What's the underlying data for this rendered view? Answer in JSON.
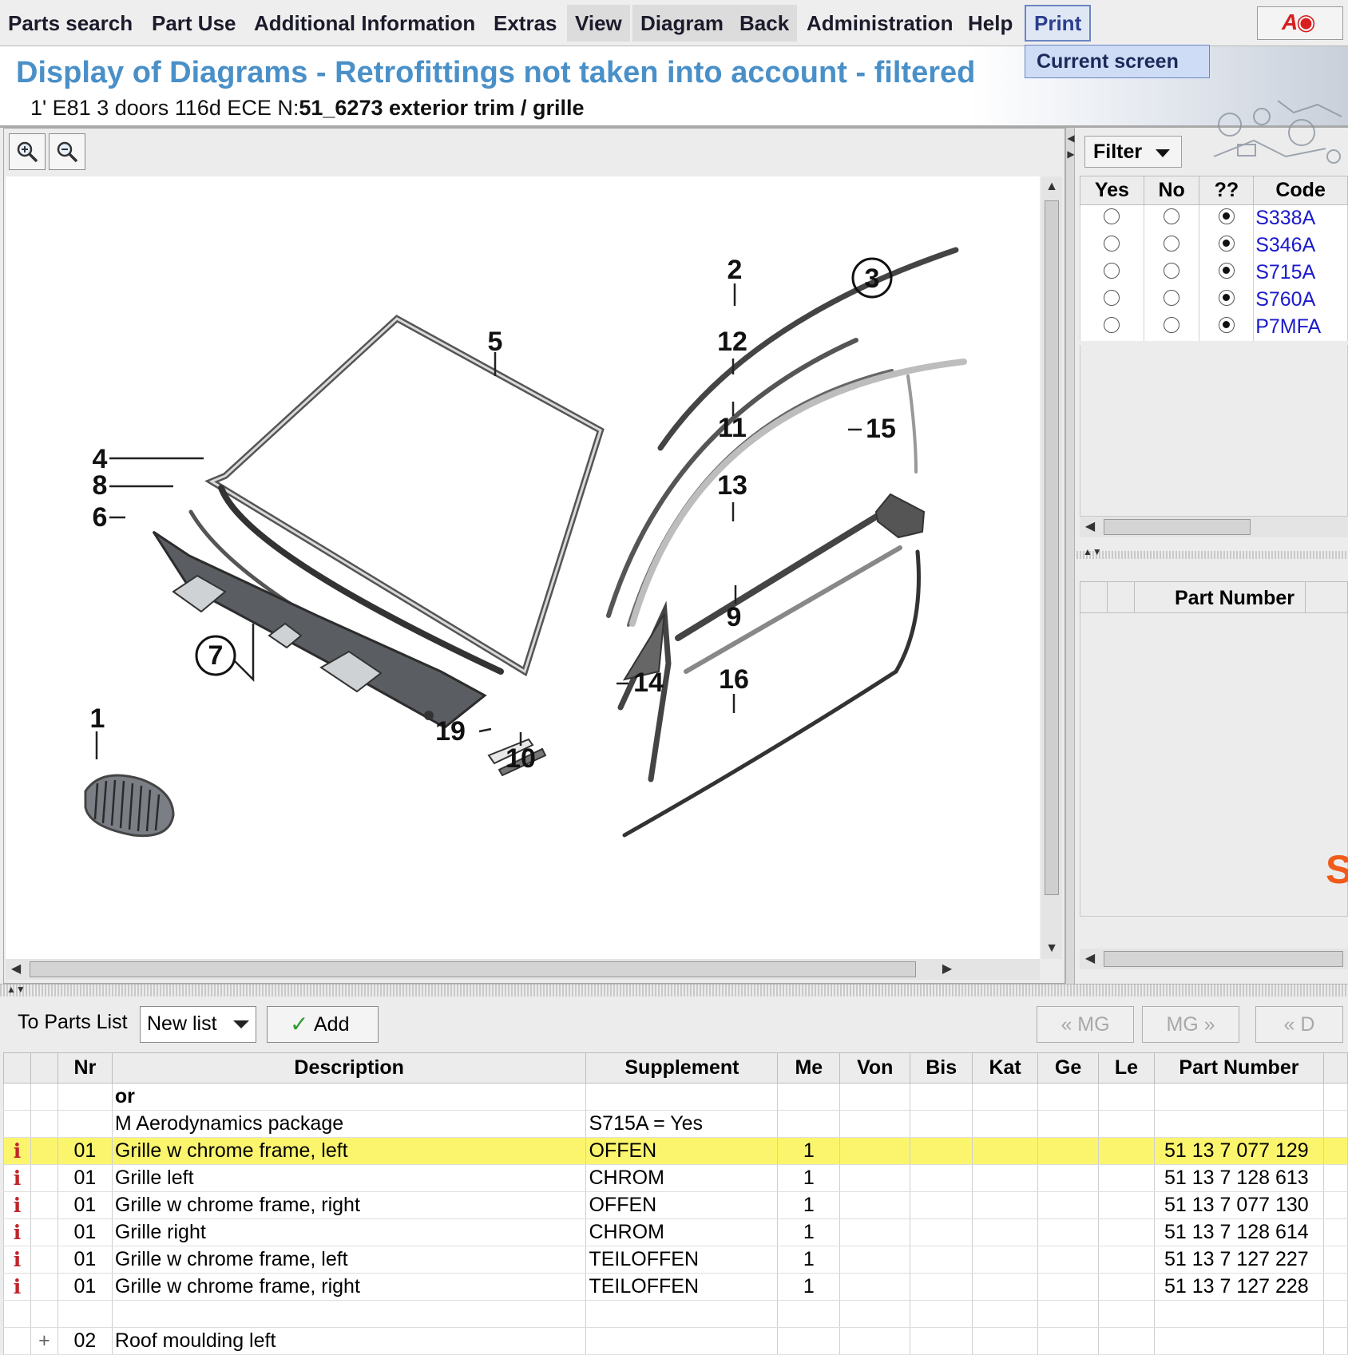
{
  "menu": [
    {
      "label": "Parts search"
    },
    {
      "label": "Part Use"
    },
    {
      "label": "Additional Information"
    },
    {
      "label": "Extras"
    },
    {
      "label": "View"
    },
    {
      "label": "Diagram"
    },
    {
      "label": "Back"
    },
    {
      "label": "Administration"
    },
    {
      "label": "Help"
    },
    {
      "label": "Print"
    }
  ],
  "print_menu": {
    "current_screen": "Current screen"
  },
  "header": {
    "title": "Display of Diagrams - Retrofittings not taken into account - filtered",
    "vehicle": "1' E81 3 doors 116d ECE  N:",
    "diagram": "51_6273 exterior trim / grille"
  },
  "diagram_labels": [
    "1",
    "2",
    "3",
    "4",
    "5",
    "6",
    "7",
    "8",
    "9",
    "10",
    "11",
    "12",
    "13",
    "14",
    "15",
    "16",
    "19"
  ],
  "filter": {
    "button_label": "Filter",
    "columns": [
      "Yes",
      "No",
      "??",
      "Code"
    ],
    "rows": [
      {
        "code": "S338A",
        "selected": "??"
      },
      {
        "code": "S346A",
        "selected": "??"
      },
      {
        "code": "S715A",
        "selected": "??"
      },
      {
        "code": "S760A",
        "selected": "??"
      },
      {
        "code": "P7MFA",
        "selected": "??"
      }
    ]
  },
  "right_parts_header": "Part Number",
  "parts_toolbar": {
    "to_parts_list": "To Parts List",
    "list_value": "New list",
    "add_label": "Add",
    "prev_mg": "« MG",
    "next_mg": "MG »",
    "prev_d": "« D"
  },
  "parts_table": {
    "columns": [
      "",
      "",
      "Nr",
      "Description",
      "Supplement",
      "Me",
      "Von",
      "Bis",
      "Kat",
      "Ge",
      "Le",
      "Part Number",
      ""
    ],
    "rows": [
      {
        "icon": "",
        "expand": "",
        "nr": "",
        "description": "or",
        "supplement": "",
        "me": "",
        "part_number": "",
        "bold": true
      },
      {
        "icon": "",
        "expand": "",
        "nr": "",
        "description": "M Aerodynamics package",
        "supplement": "S715A = Yes",
        "me": "",
        "part_number": ""
      },
      {
        "icon": "i",
        "expand": "",
        "nr": "01",
        "description": "Grille w chrome frame, left",
        "supplement": "OFFEN",
        "me": "1",
        "part_number": "51 13 7 077 129",
        "highlight": true
      },
      {
        "icon": "i",
        "expand": "",
        "nr": "01",
        "description": "Grille left",
        "supplement": "CHROM",
        "me": "1",
        "part_number": "51 13 7 128 613"
      },
      {
        "icon": "i",
        "expand": "",
        "nr": "01",
        "description": "Grille w chrome frame, right",
        "supplement": "OFFEN",
        "me": "1",
        "part_number": "51 13 7 077 130"
      },
      {
        "icon": "i",
        "expand": "",
        "nr": "01",
        "description": "Grille right",
        "supplement": "CHROM",
        "me": "1",
        "part_number": "51 13 7 128 614"
      },
      {
        "icon": "i",
        "expand": "",
        "nr": "01",
        "description": "Grille w chrome frame, left",
        "supplement": "TEILOFFEN",
        "me": "1",
        "part_number": "51 13 7 127 227"
      },
      {
        "icon": "i",
        "expand": "",
        "nr": "01",
        "description": "Grille w chrome frame, right",
        "supplement": "TEILOFFEN",
        "me": "1",
        "part_number": "51 13 7 127 228"
      },
      {
        "icon": "",
        "expand": "",
        "nr": "",
        "description": "",
        "supplement": "",
        "me": "",
        "part_number": ""
      },
      {
        "icon": "",
        "expand": "+",
        "nr": "02",
        "description": "Roof moulding left",
        "supplement": "",
        "me": "",
        "part_number": ""
      }
    ]
  }
}
